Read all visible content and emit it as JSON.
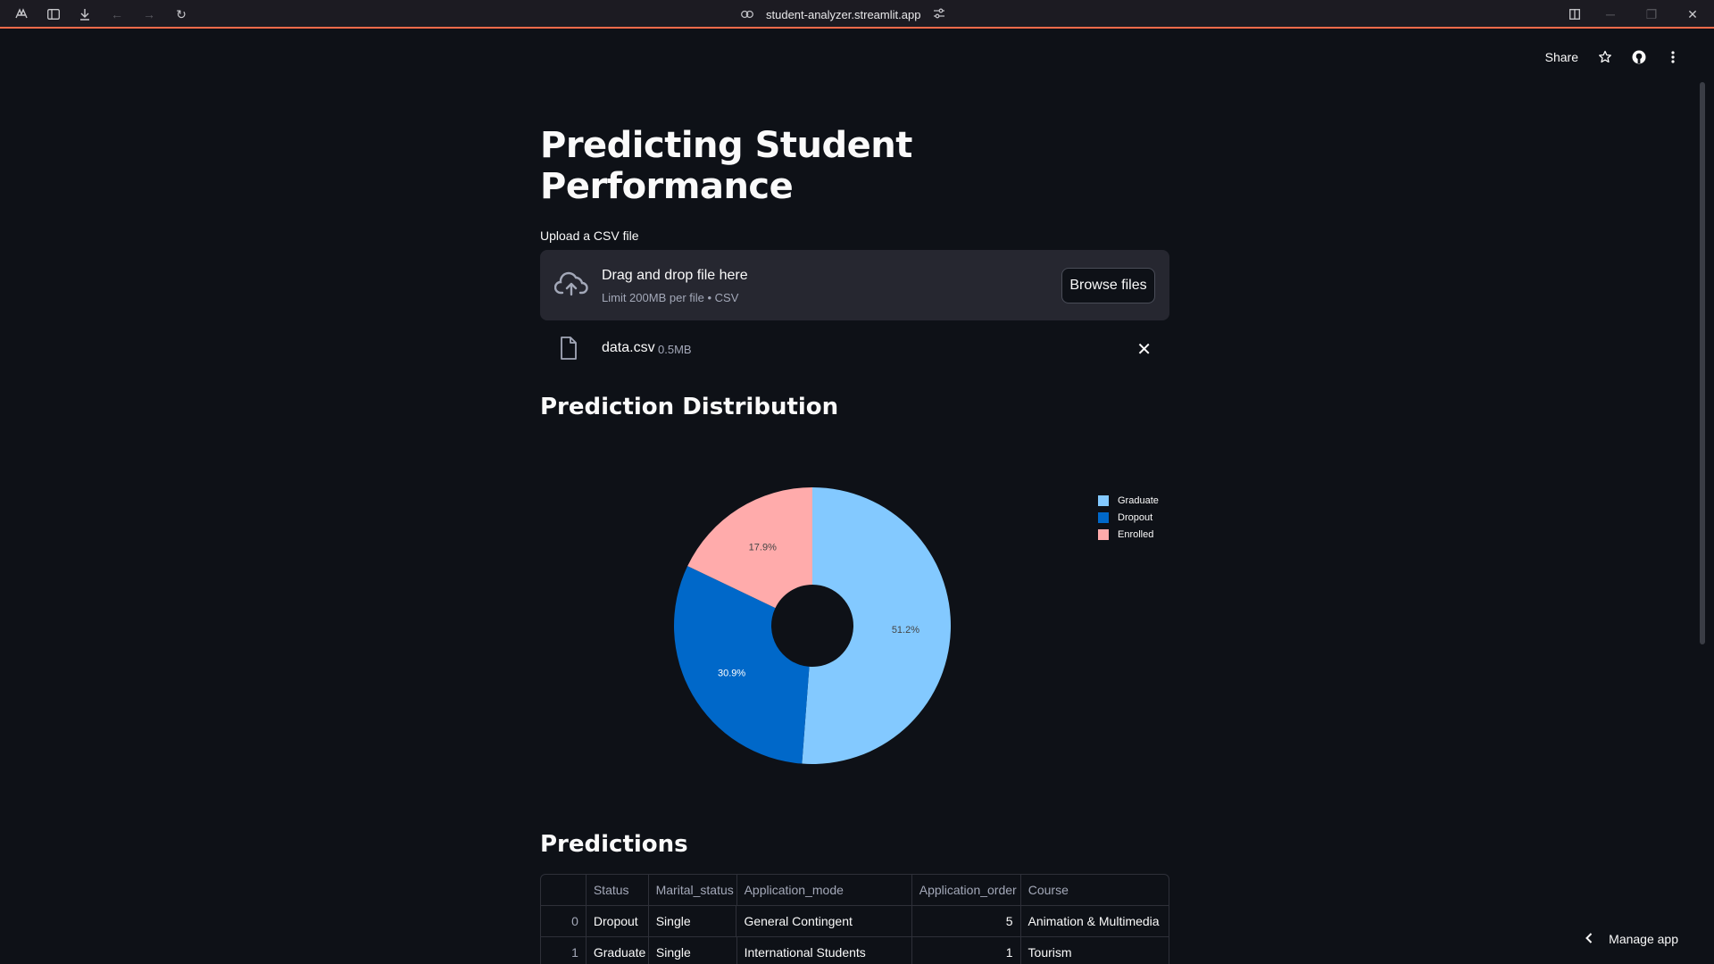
{
  "browser": {
    "url": "student-analyzer.streamlit.app"
  },
  "header": {
    "share_label": "Share"
  },
  "page": {
    "title": "Predicting Student Performance",
    "upload_label": "Upload a CSV file",
    "dropzone_title": "Drag and drop file here",
    "dropzone_sub": "Limit 200MB per file • CSV",
    "browse_label": "Browse files",
    "file_name": "data.csv",
    "file_size": "0.5MB",
    "section_distribution": "Prediction Distribution",
    "section_predictions": "Predictions"
  },
  "chart_data": {
    "type": "pie",
    "hole": true,
    "labels": [
      "Graduate",
      "Dropout",
      "Enrolled"
    ],
    "values": [
      51.2,
      30.9,
      17.9
    ],
    "value_labels": [
      "51.2%",
      "30.9%",
      "17.9%"
    ],
    "colors": [
      "#83c9ff",
      "#0068c9",
      "#ffabab"
    ],
    "legend_position": "top-right"
  },
  "table": {
    "columns": [
      "",
      "Status",
      "Marital_status",
      "Application_mode",
      "Application_order",
      "Course"
    ],
    "rows": [
      [
        "0",
        "Dropout",
        "Single",
        "General Contingent",
        "5",
        "Animation & Multimedia"
      ],
      [
        "1",
        "Graduate",
        "Single",
        "International Students",
        "1",
        "Tourism"
      ]
    ]
  },
  "footer": {
    "manage_label": "Manage app"
  }
}
